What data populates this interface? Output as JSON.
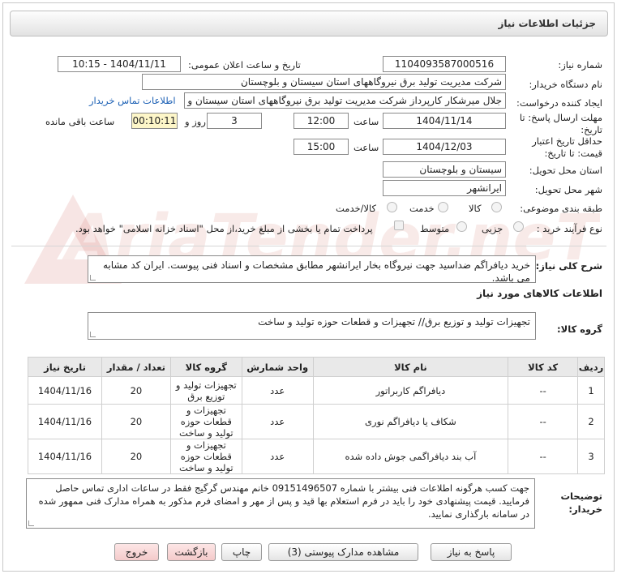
{
  "header": {
    "title": "جزئیات اطلاعات نیاز"
  },
  "fields": {
    "need_number_label": "شماره نیاز:",
    "need_number": "1104093587000516",
    "announce_label": "تاریخ و ساعت اعلان عمومی:",
    "announce_value": "1404/11/11 - 10:15",
    "buyer_org_label": "نام دستگاه خریدار:",
    "buyer_org": "شرکت مدیریت تولید برق نیروگاههای استان سیستان و بلوچستان",
    "creator_label": "ایجاد کننده درخواست:",
    "creator": "جلال میرشکار کارپرداز شرکت مدیریت تولید برق نیروگاههای استان سیستان و با",
    "contact_link": "اطلاعات تماس خریدار",
    "deadline_label_1": "مهلت ارسال پاسخ: تا",
    "deadline_label_2": "تاریخ:",
    "deadline_date": "1404/11/14",
    "time_label": "ساعت",
    "deadline_time": "12:00",
    "days_value": "3",
    "days_label": "روز و",
    "remaining_time": "00:10:11",
    "remaining_label": "ساعت باقی مانده",
    "validity_label_1": "حداقل تاریخ اعتبار",
    "validity_label_2": "قیمت: تا تاریخ:",
    "validity_date": "1404/12/03",
    "validity_time": "15:00",
    "province_label": "استان محل تحویل:",
    "province": "سیستان و بلوچستان",
    "city_label": "شهر محل تحویل:",
    "city": "ایرانشهر",
    "category_label": "طبقه بندی موضوعی:",
    "category_options": [
      "کالا",
      "خدمت",
      "کالا/خدمت"
    ],
    "process_label": "نوع فرآیند خرید :",
    "process_options": [
      "جزیی",
      "متوسط"
    ],
    "payment_note": "پرداخت تمام یا بخشی از مبلغ خرید،از محل \"اسناد خزانه اسلامی\" خواهد بود."
  },
  "description": {
    "label": "شرح کلی نیاز:",
    "text": "خرید دیافراگم ضداسید جهت نیروگاه بخار ایرانشهر مطابق مشخصات و اسناد فنی پیوست. ایران کد مشابه می باشد."
  },
  "goods": {
    "section_title": "اطلاعات کالاهای مورد نیاز",
    "group_label": "گروه کالا:",
    "group_value": "تجهیزات تولید و توزیع برق// تجهیزات و قطعات حوزه تولید و ساخت"
  },
  "table": {
    "headers": [
      "ردیف",
      "کد کالا",
      "نام کالا",
      "واحد شمارش",
      "گروه کالا",
      "تعداد / مقدار",
      "تاریخ نیاز"
    ],
    "rows": [
      {
        "row": "1",
        "code": "--",
        "name": "دیافراگم کاربراتور",
        "unit": "عدد",
        "group": "تجهیزات تولید و توزیع برق",
        "qty": "20",
        "date": "1404/11/16"
      },
      {
        "row": "2",
        "code": "--",
        "name": "شکاف یا دیافراگم نوری",
        "unit": "عدد",
        "group": "تجهیزات و قطعات حوزه تولید و ساخت",
        "qty": "20",
        "date": "1404/11/16"
      },
      {
        "row": "3",
        "code": "--",
        "name": "آب بند دیافراگمی جوش داده شده",
        "unit": "عدد",
        "group": "تجهیزات و قطعات حوزه تولید و ساخت",
        "qty": "20",
        "date": "1404/11/16"
      }
    ]
  },
  "buyer_notes": {
    "label_1": "توضیحات",
    "label_2": "خریدار:",
    "text": "جهت کسب هرگونه اطلاعات فنی بیشتر با شماره 09151496507 خانم مهندس گرگیج فقط در ساعات اداری تماس حاصل فرمایید. قیمت پیشنهادی خود را باید در فرم استعلام بها قید و پس از مهر و امضای فرم مذکور به همراه مدارک فنی ممهور شده در سامانه بارگذاری نمایید."
  },
  "buttons": {
    "reply": "پاسخ به نیاز",
    "view_docs": "مشاهده مدارک پیوستی (3)",
    "print": "چاپ",
    "back": "بازگشت",
    "exit": "خروج"
  },
  "watermark_text": "AriaTender.neT",
  "colors": {
    "accent_link": "#1a5fb4",
    "remaining_bg": "#fdf6c8",
    "watermark": "#e7b0b0"
  }
}
